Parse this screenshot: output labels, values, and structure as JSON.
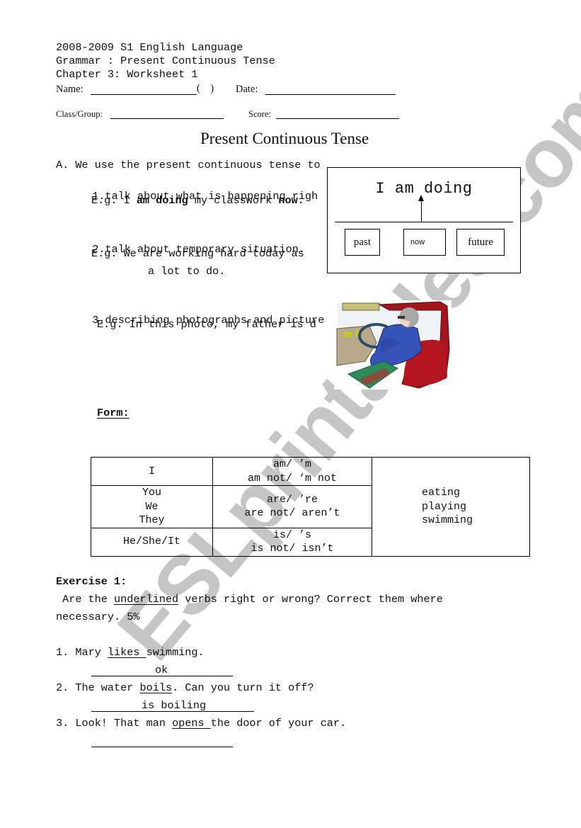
{
  "header": {
    "line1": "2008-2009 S1 English Language",
    "line2": "Grammar : Present Continuous Tense",
    "line3": "Chapter 3: Worksheet 1",
    "name_label": "Name:",
    "class_no_brackets": "(    )",
    "date_label": "Date:",
    "class_group_label": "Class/Group:",
    "score_label": "Score:"
  },
  "title": "Present Continuous Tense",
  "section_a": {
    "intro": "A. We use the present continuous tense to",
    "uses": [
      {
        "number": "1.",
        "text": "talk about what is happening righ",
        "example_prefix": "E.g. I ",
        "example_bold1": "am doing",
        "example_mid": " my classwork ",
        "example_bold2": "now.",
        "example_suffix": ""
      },
      {
        "number": "2.",
        "text": "talk about temporary situation.",
        "example_line1": "E.g. We are working hard today as",
        "example_line2": "a lot to do."
      },
      {
        "number": "3.",
        "text": "describing photographs and picture",
        "example_line1": "E.g. In this photo, my father is d"
      }
    ]
  },
  "diagram": {
    "title": "I am doing",
    "timeline": [
      "past",
      "now",
      "future"
    ]
  },
  "picture": {
    "description": "man driving a car illustration"
  },
  "form": {
    "heading": "Form:",
    "rows": [
      {
        "subjects": [
          "I"
        ],
        "verbs": [
          "am/ ’m",
          "am not/ ‘m not"
        ]
      },
      {
        "subjects": [
          "You",
          "We",
          "They"
        ],
        "verbs": [
          "are/ ’re",
          "are not/ aren’t"
        ]
      },
      {
        "subjects": [
          "He/She/It"
        ],
        "verbs": [
          "is/ ’s",
          "is not/ isn’t"
        ]
      }
    ],
    "ing_forms": [
      "eating",
      "playing",
      "swimming"
    ]
  },
  "exercise1": {
    "heading": "Exercise 1:",
    "instruction_pre": " Are the ",
    "instruction_underlined": "underlined",
    "instruction_post": " verbs right or wrong? Correct them where",
    "instruction_line2": "necessary. 5%",
    "items": [
      {
        "number": "1.",
        "pre": " Mary ",
        "underlined": "likes ",
        "post": "swimming.",
        "answer": "ok"
      },
      {
        "number": "2.",
        "pre": " The water ",
        "underlined": "boils",
        "post": ". Can you turn it off?",
        "answer": "is boiling"
      },
      {
        "number": "3.",
        "pre": " Look! That man ",
        "underlined": "opens ",
        "post": "the door of your car.",
        "answer": ""
      }
    ]
  },
  "watermark": "ESLprintables.com"
}
